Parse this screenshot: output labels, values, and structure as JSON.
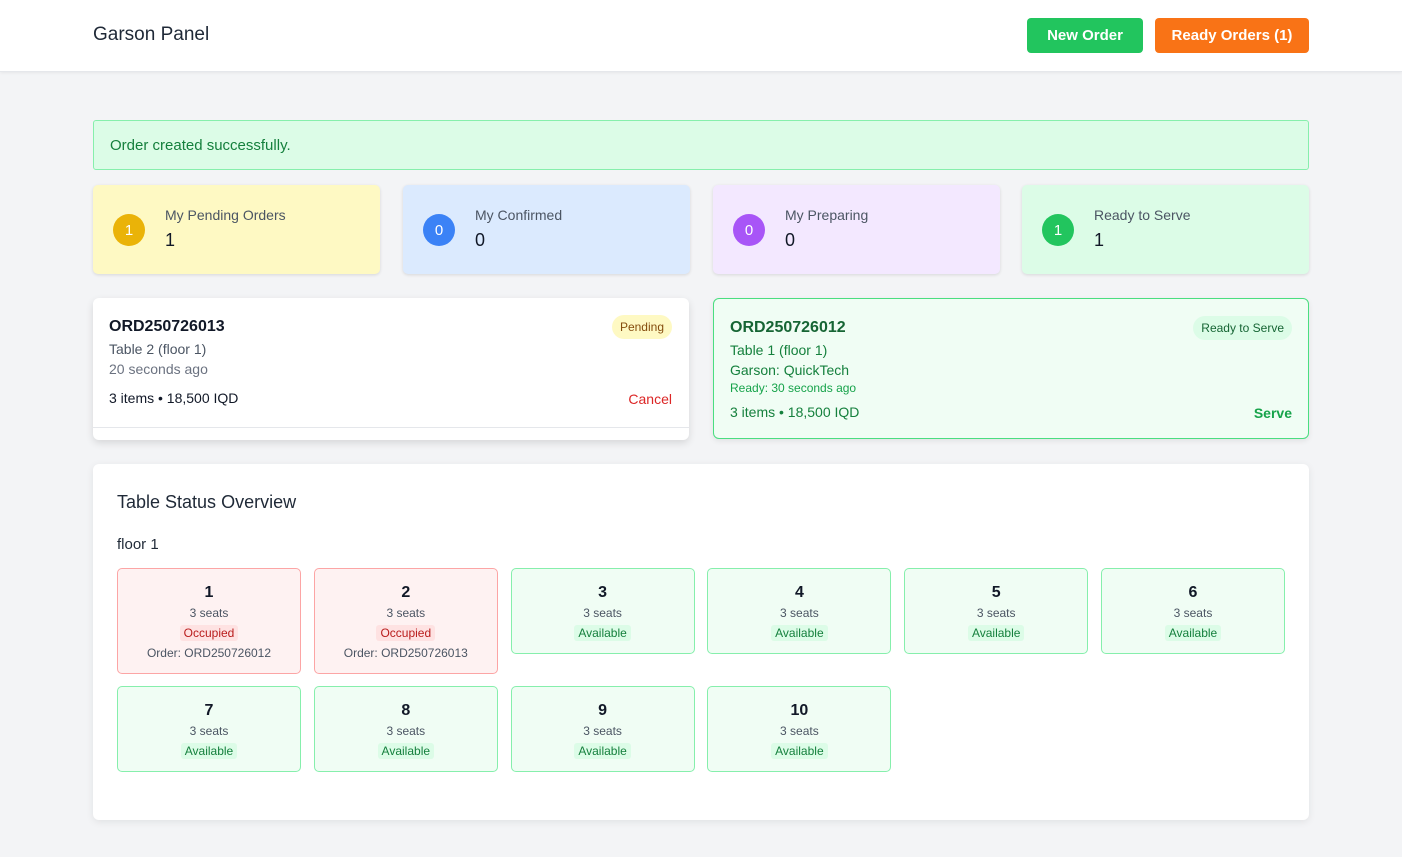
{
  "header": {
    "title": "Garson Panel",
    "new_order": "New Order",
    "ready_orders": "Ready Orders (1)"
  },
  "alert": {
    "message": "Order created successfully."
  },
  "stats": [
    {
      "label": "My Pending Orders",
      "value": "1",
      "color": "#eab308",
      "bg": "#fef9c3"
    },
    {
      "label": "My Confirmed",
      "value": "0",
      "color": "#3b82f6",
      "bg": "#dbeafe"
    },
    {
      "label": "My Preparing",
      "value": "0",
      "color": "#a855f7",
      "bg": "#f3e8ff"
    },
    {
      "label": "Ready to Serve",
      "value": "1",
      "color": "#22c55e",
      "bg": "#dcfce7"
    }
  ],
  "orders": {
    "pending": {
      "id": "ORD250726013",
      "table": "Table 2 (floor 1)",
      "time": "20 seconds ago",
      "summary": "3 items • 18,500 IQD",
      "status": "Pending",
      "action": "Cancel"
    },
    "ready": {
      "id": "ORD250726012",
      "table": "Table 1 (floor 1)",
      "waiter": "Garson: QuickTech",
      "ready_time": "Ready: 30 seconds ago",
      "summary": "3 items • 18,500 IQD",
      "status": "Ready to Serve",
      "action": "Serve"
    }
  },
  "tables_panel": {
    "title": "Table Status Overview",
    "floor": "floor 1",
    "tables": [
      {
        "number": "1",
        "seats": "3 seats",
        "status": "Occupied",
        "order": "Order: ORD250726012"
      },
      {
        "number": "2",
        "seats": "3 seats",
        "status": "Occupied",
        "order": "Order: ORD250726013"
      },
      {
        "number": "3",
        "seats": "3 seats",
        "status": "Available"
      },
      {
        "number": "4",
        "seats": "3 seats",
        "status": "Available"
      },
      {
        "number": "5",
        "seats": "3 seats",
        "status": "Available"
      },
      {
        "number": "6",
        "seats": "3 seats",
        "status": "Available"
      },
      {
        "number": "7",
        "seats": "3 seats",
        "status": "Available"
      },
      {
        "number": "8",
        "seats": "3 seats",
        "status": "Available"
      },
      {
        "number": "9",
        "seats": "3 seats",
        "status": "Available"
      },
      {
        "number": "10",
        "seats": "3 seats",
        "status": "Available"
      }
    ]
  }
}
